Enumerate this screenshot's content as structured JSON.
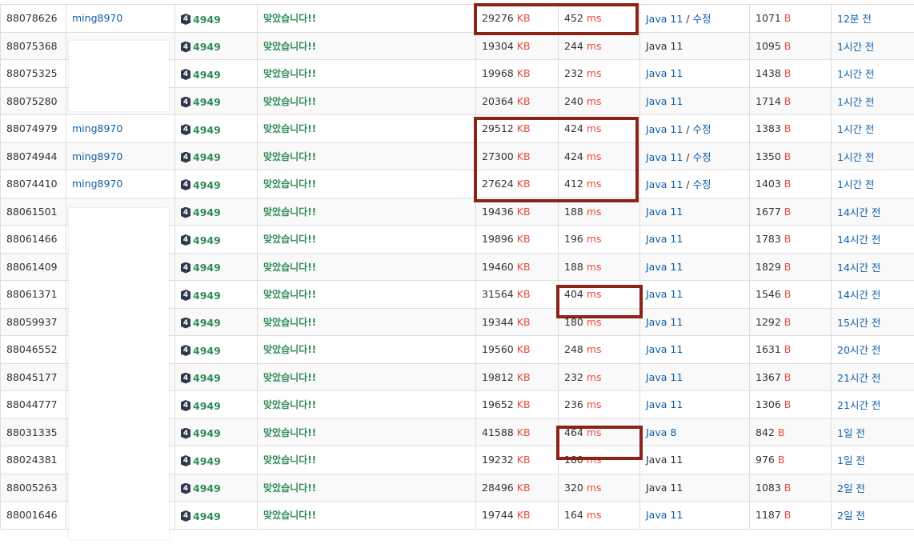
{
  "colors": {
    "link": "#0f5ea8",
    "unit": "#e74c3c",
    "accepted": "#2e8b57",
    "highlight": "#8b2316"
  },
  "tier_icon": "gold-4-tier-icon",
  "rows": [
    {
      "id": "88078626",
      "user": "ming8970",
      "problem": "4949",
      "tier": "4",
      "result": "맞았습니다!!",
      "memory": "29276",
      "mem_unit": "KB",
      "time": "452",
      "time_unit": "ms",
      "lang": "Java 11",
      "edit": "수정",
      "lang_link": true,
      "length": "1071",
      "len_unit": "B",
      "ago": "12분 전"
    },
    {
      "id": "88075368",
      "user": "",
      "problem": "4949",
      "tier": "4",
      "result": "맞았습니다!!",
      "memory": "19304",
      "mem_unit": "KB",
      "time": "244",
      "time_unit": "ms",
      "lang": "Java 11",
      "edit": "",
      "lang_link": false,
      "length": "1095",
      "len_unit": "B",
      "ago": "1시간 전"
    },
    {
      "id": "88075325",
      "user": "",
      "problem": "4949",
      "tier": "4",
      "result": "맞았습니다!!",
      "memory": "19968",
      "mem_unit": "KB",
      "time": "232",
      "time_unit": "ms",
      "lang": "Java 11",
      "edit": "",
      "lang_link": true,
      "length": "1438",
      "len_unit": "B",
      "ago": "1시간 전"
    },
    {
      "id": "88075280",
      "user": "",
      "problem": "4949",
      "tier": "4",
      "result": "맞았습니다!!",
      "memory": "20364",
      "mem_unit": "KB",
      "time": "240",
      "time_unit": "ms",
      "lang": "Java 11",
      "edit": "",
      "lang_link": true,
      "length": "1714",
      "len_unit": "B",
      "ago": "1시간 전"
    },
    {
      "id": "88074979",
      "user": "ming8970",
      "problem": "4949",
      "tier": "4",
      "result": "맞았습니다!!",
      "memory": "29512",
      "mem_unit": "KB",
      "time": "424",
      "time_unit": "ms",
      "lang": "Java 11",
      "edit": "수정",
      "lang_link": true,
      "length": "1383",
      "len_unit": "B",
      "ago": "1시간 전"
    },
    {
      "id": "88074944",
      "user": "ming8970",
      "problem": "4949",
      "tier": "4",
      "result": "맞았습니다!!",
      "memory": "27300",
      "mem_unit": "KB",
      "time": "424",
      "time_unit": "ms",
      "lang": "Java 11",
      "edit": "수정",
      "lang_link": true,
      "length": "1350",
      "len_unit": "B",
      "ago": "1시간 전"
    },
    {
      "id": "88074410",
      "user": "ming8970",
      "problem": "4949",
      "tier": "4",
      "result": "맞았습니다!!",
      "memory": "27624",
      "mem_unit": "KB",
      "time": "412",
      "time_unit": "ms",
      "lang": "Java 11",
      "edit": "수정",
      "lang_link": true,
      "length": "1403",
      "len_unit": "B",
      "ago": "1시간 전"
    },
    {
      "id": "88061501",
      "user": "",
      "problem": "4949",
      "tier": "4",
      "result": "맞았습니다!!",
      "memory": "19436",
      "mem_unit": "KB",
      "time": "188",
      "time_unit": "ms",
      "lang": "Java 11",
      "edit": "",
      "lang_link": true,
      "length": "1677",
      "len_unit": "B",
      "ago": "14시간 전"
    },
    {
      "id": "88061466",
      "user": "",
      "problem": "4949",
      "tier": "4",
      "result": "맞았습니다!!",
      "memory": "19896",
      "mem_unit": "KB",
      "time": "196",
      "time_unit": "ms",
      "lang": "Java 11",
      "edit": "",
      "lang_link": true,
      "length": "1783",
      "len_unit": "B",
      "ago": "14시간 전"
    },
    {
      "id": "88061409",
      "user": "",
      "problem": "4949",
      "tier": "4",
      "result": "맞았습니다!!",
      "memory": "19460",
      "mem_unit": "KB",
      "time": "188",
      "time_unit": "ms",
      "lang": "Java 11",
      "edit": "",
      "lang_link": true,
      "length": "1829",
      "len_unit": "B",
      "ago": "14시간 전"
    },
    {
      "id": "88061371",
      "user": "",
      "problem": "4949",
      "tier": "4",
      "result": "맞았습니다!!",
      "memory": "31564",
      "mem_unit": "KB",
      "time": "404",
      "time_unit": "ms",
      "lang": "Java 11",
      "edit": "",
      "lang_link": true,
      "length": "1546",
      "len_unit": "B",
      "ago": "14시간 전"
    },
    {
      "id": "88059937",
      "user": "",
      "problem": "4949",
      "tier": "4",
      "result": "맞았습니다!!",
      "memory": "19344",
      "mem_unit": "KB",
      "time": "180",
      "time_unit": "ms",
      "lang": "Java 11",
      "edit": "",
      "lang_link": true,
      "length": "1292",
      "len_unit": "B",
      "ago": "15시간 전"
    },
    {
      "id": "88046552",
      "user": "",
      "problem": "4949",
      "tier": "4",
      "result": "맞았습니다!!",
      "memory": "19560",
      "mem_unit": "KB",
      "time": "248",
      "time_unit": "ms",
      "lang": "Java 11",
      "edit": "",
      "lang_link": true,
      "length": "1631",
      "len_unit": "B",
      "ago": "20시간 전"
    },
    {
      "id": "88045177",
      "user": "",
      "problem": "4949",
      "tier": "4",
      "result": "맞았습니다!!",
      "memory": "19812",
      "mem_unit": "KB",
      "time": "232",
      "time_unit": "ms",
      "lang": "Java 11",
      "edit": "",
      "lang_link": true,
      "length": "1367",
      "len_unit": "B",
      "ago": "21시간 전"
    },
    {
      "id": "88044777",
      "user": "",
      "problem": "4949",
      "tier": "4",
      "result": "맞았습니다!!",
      "memory": "19652",
      "mem_unit": "KB",
      "time": "236",
      "time_unit": "ms",
      "lang": "Java 11",
      "edit": "",
      "lang_link": true,
      "length": "1306",
      "len_unit": "B",
      "ago": "21시간 전"
    },
    {
      "id": "88031335",
      "user": "",
      "problem": "4949",
      "tier": "4",
      "result": "맞았습니다!!",
      "memory": "41588",
      "mem_unit": "KB",
      "time": "464",
      "time_unit": "ms",
      "lang": "Java 8",
      "edit": "",
      "lang_link": true,
      "length": "842",
      "len_unit": "B",
      "ago": "1일 전"
    },
    {
      "id": "88024381",
      "user": "",
      "problem": "4949",
      "tier": "4",
      "result": "맞았습니다!!",
      "memory": "19232",
      "mem_unit": "KB",
      "time": "180",
      "time_unit": "ms",
      "lang": "Java 11",
      "edit": "",
      "lang_link": false,
      "length": "976",
      "len_unit": "B",
      "ago": "1일 전"
    },
    {
      "id": "88005263",
      "user": "",
      "problem": "4949",
      "tier": "4",
      "result": "맞았습니다!!",
      "memory": "28496",
      "mem_unit": "KB",
      "time": "320",
      "time_unit": "ms",
      "lang": "Java 11",
      "edit": "",
      "lang_link": false,
      "length": "1083",
      "len_unit": "B",
      "ago": "2일 전"
    },
    {
      "id": "88001646",
      "user": "",
      "problem": "4949",
      "tier": "4",
      "result": "맞았습니다!!",
      "memory": "19744",
      "mem_unit": "KB",
      "time": "164",
      "time_unit": "ms",
      "lang": "Java 11",
      "edit": "",
      "lang_link": true,
      "length": "1187",
      "len_unit": "B",
      "ago": "2일 전"
    }
  ]
}
